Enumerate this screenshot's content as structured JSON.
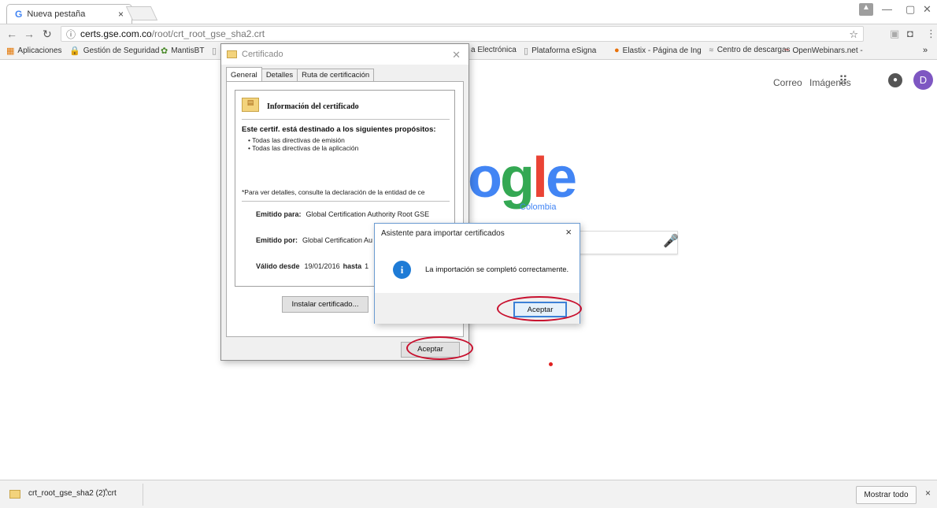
{
  "browser": {
    "tab_title": "Nueva pestaña",
    "tab_close": "×",
    "url_host": "certs.gse.com.co",
    "url_path": "/root/crt_root_gse_sha2.crt",
    "bookmarks": [
      "Aplicaciones",
      "Gestión de Seguridad",
      "MantisBT",
      "a Electrónica",
      "Plataforma eSigna",
      "Elastix - Página de Ing",
      "Centro de descargas",
      "OpenWebinars.net -"
    ],
    "more_bookmarks": "»"
  },
  "google": {
    "links": [
      "Correo",
      "Imágenes"
    ],
    "avatar_letter": "D",
    "logo_letters": [
      "o",
      "g",
      "l",
      "e"
    ],
    "logo_sub": "Colombia"
  },
  "certificate_dialog": {
    "title": "Certificado",
    "tabs": [
      "General",
      "Detalles",
      "Ruta de certificación"
    ],
    "info_title": "Información del certificado",
    "purpose_heading": "Este certif. está destinado a los siguientes propósitos:",
    "purposes": [
      "• Todas las directivas de emisión",
      "• Todas las directivas de la aplicación"
    ],
    "note": "*Para ver detalles, consulte la declaración de la entidad de ce",
    "issued_to_label": "Emitido para:",
    "issued_to_value": "Global Certification Authority Root GSE",
    "issued_by_label": "Emitido por:",
    "issued_by_value": "Global Certification Au",
    "valid_from_label": "Válido desde",
    "valid_from_value": "19/01/2016",
    "valid_to_label": "hasta",
    "valid_to_value": "1",
    "install_button": "Instalar certificado...",
    "accept_button": "Aceptar"
  },
  "import_dialog": {
    "title": "Asistente para importar certificados",
    "close": "×",
    "message": "La importación se completó correctamente.",
    "accept_button": "Aceptar"
  },
  "download_bar": {
    "file_name": "crt_root_gse_sha2 (2).crt",
    "show_all": "Mostrar todo",
    "close": "×"
  }
}
